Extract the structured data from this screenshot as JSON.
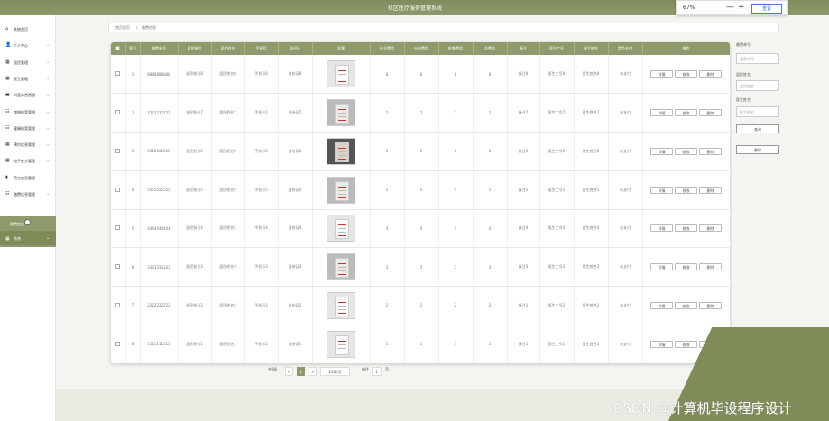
{
  "app": {
    "title": "社区医疗服务管理系统"
  },
  "zoom": {
    "value": "67%",
    "minus": "—",
    "plus": "+",
    "reset_label": "重置"
  },
  "sidebar": {
    "items": [
      {
        "label": "系统首页",
        "icon": "home-icon",
        "glyph": "⌂",
        "chevron": ""
      },
      {
        "label": "个人中心",
        "icon": "user-icon",
        "glyph": "👤",
        "chevron": "⌄"
      },
      {
        "label": "居民管理",
        "icon": "grid-icon",
        "glyph": "▦",
        "chevron": "⌄"
      },
      {
        "label": "医生管理",
        "icon": "grid-icon",
        "glyph": "▦",
        "chevron": "⌄"
      },
      {
        "label": "科室分类管理",
        "icon": "book-icon",
        "glyph": "▬",
        "chevron": "⌄"
      },
      {
        "label": "病例档案管理",
        "icon": "list-icon",
        "glyph": "☷",
        "chevron": "⌄"
      },
      {
        "label": "健康档案管理",
        "icon": "list-icon",
        "glyph": "☷",
        "chevron": "⌄"
      },
      {
        "label": "预约信息管理",
        "icon": "grid-icon",
        "glyph": "▦",
        "chevron": "⌄"
      },
      {
        "label": "电子处方管理",
        "icon": "grid-icon",
        "glyph": "▦",
        "chevron": "⌄"
      },
      {
        "label": "药方信息管理",
        "icon": "chart-icon",
        "glyph": "▮",
        "chevron": "⌄"
      },
      {
        "label": "缴费信息管理",
        "icon": "list-icon",
        "glyph": "☷",
        "chevron": "⌄"
      }
    ],
    "active_sub": "缴费信息",
    "active_item": {
      "label": "系统",
      "glyph": "▦",
      "chevron": "⌄"
    }
  },
  "breadcrumb": {
    "home": "首页首页",
    "sep": "/",
    "current": "缴费信息"
  },
  "table": {
    "headers": [
      "",
      "索引",
      "缴费单号",
      "居民账号",
      "居民姓名",
      "手机号",
      "身份证",
      "发票",
      "挂号费用",
      "出诊费用",
      "检查费用",
      "总费用",
      "备注",
      "医生工号",
      "医生姓名",
      "是否支付",
      "操作"
    ],
    "rows": [
      {
        "index": "1",
        "bill_no": "8888888888",
        "account": "居民账号8",
        "name": "居民姓名8",
        "phone": "手机号8",
        "id_card": "身份证8",
        "img": "light",
        "reg": "8",
        "visit": "8",
        "check": "8",
        "total": "8",
        "note": "备注8",
        "doc_no": "医生工号8",
        "doc_name": "医生姓名8",
        "paid": "未支付"
      },
      {
        "index": "2",
        "bill_no": "7777777777",
        "account": "居民账号7",
        "name": "居民姓名7",
        "phone": "手机号7",
        "id_card": "身份证7",
        "img": "mid",
        "reg": "7",
        "visit": "7",
        "check": "7",
        "total": "7",
        "note": "备注7",
        "doc_no": "医生工号7",
        "doc_name": "医生姓名7",
        "paid": "未支付"
      },
      {
        "index": "3",
        "bill_no": "6666666666",
        "account": "居民账号6",
        "name": "居民姓名6",
        "phone": "手机号6",
        "id_card": "身份证6",
        "img": "dark",
        "reg": "6",
        "visit": "6",
        "check": "6",
        "total": "6",
        "note": "备注6",
        "doc_no": "医生工号6",
        "doc_name": "医生姓名6",
        "paid": "未支付"
      },
      {
        "index": "4",
        "bill_no": "5555555555",
        "account": "居民账号5",
        "name": "居民姓名5",
        "phone": "手机号5",
        "id_card": "身份证5",
        "img": "mid",
        "reg": "5",
        "visit": "5",
        "check": "5",
        "total": "5",
        "note": "备注5",
        "doc_no": "医生工号5",
        "doc_name": "医生姓名5",
        "paid": "未支付"
      },
      {
        "index": "5",
        "bill_no": "4444444444",
        "account": "居民账号4",
        "name": "居民姓名4",
        "phone": "手机号4",
        "id_card": "身份证4",
        "img": "light",
        "reg": "4",
        "visit": "4",
        "check": "4",
        "total": "4",
        "note": "备注4",
        "doc_no": "医生工号4",
        "doc_name": "医生姓名4",
        "paid": "未支付"
      },
      {
        "index": "6",
        "bill_no": "3333333333",
        "account": "居民账号3",
        "name": "居民姓名3",
        "phone": "手机号3",
        "id_card": "身份证3",
        "img": "mid",
        "reg": "3",
        "visit": "3",
        "check": "3",
        "total": "3",
        "note": "备注3",
        "doc_no": "医生工号3",
        "doc_name": "医生姓名3",
        "paid": "未支付"
      },
      {
        "index": "7",
        "bill_no": "2222222222",
        "account": "居民账号2",
        "name": "居民姓名2",
        "phone": "手机号2",
        "id_card": "身份证2",
        "img": "light",
        "reg": "2",
        "visit": "2",
        "check": "2",
        "total": "2",
        "note": "备注2",
        "doc_no": "医生工号2",
        "doc_name": "医生姓名2",
        "paid": "未支付"
      },
      {
        "index": "8",
        "bill_no": "1111111111",
        "account": "居民账号1",
        "name": "居民姓名1",
        "phone": "手机号1",
        "id_card": "身份证1",
        "img": "light",
        "reg": "1",
        "visit": "1",
        "check": "1",
        "total": "1",
        "note": "备注1",
        "doc_no": "医生工号1",
        "doc_name": "医生姓名1",
        "paid": "未支付"
      }
    ],
    "actions": {
      "detail": "详情",
      "edit": "修改",
      "delete": "删除"
    }
  },
  "search": {
    "bill_label": "缴费单号",
    "bill_placeholder": "缴费单号",
    "account_label": "居民姓名",
    "account_placeholder": "居民姓名",
    "doctor_label": "医生姓名",
    "doctor_placeholder": "医生姓名",
    "query_label": "查询",
    "delete_label": "删除"
  },
  "pager": {
    "total": "共8条",
    "prev": "<",
    "current_page": "1",
    "next": ">",
    "page_size": "10条/页",
    "goto_prefix": "前往",
    "goto_value": "1",
    "goto_suffix": "页"
  },
  "watermark": "CSDN @计算机毕设程序设计",
  "colors": {
    "accent": "#8e9a6b",
    "accent_dark": "#7f8c5a"
  }
}
